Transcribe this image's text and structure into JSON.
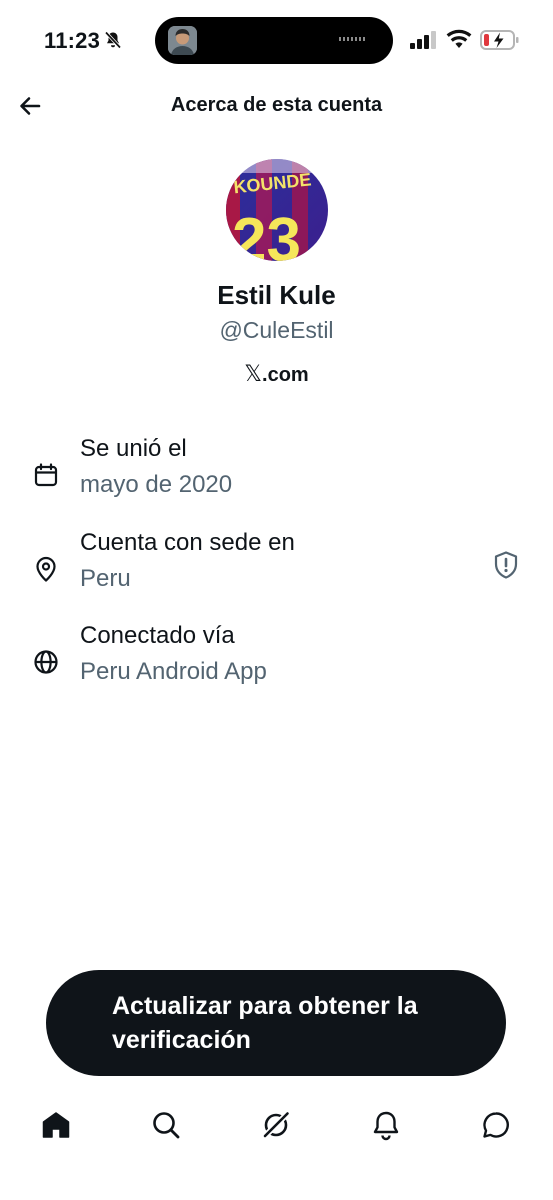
{
  "status_bar": {
    "time": "11:23",
    "icons": [
      "bell-slash-icon",
      "signal-icon",
      "wifi-icon",
      "battery-charging-icon"
    ],
    "battery_color": "#e0383e"
  },
  "header": {
    "title": "Acerca de esta cuenta",
    "back_icon": "arrow-left-icon"
  },
  "profile": {
    "display_name": "Estil Kule",
    "handle": "@CuleEstil",
    "domain_glyph": "𝕏",
    "domain_suffix": ".com",
    "avatar_jersey_text": "KOUNDE",
    "avatar_jersey_number": "23"
  },
  "info": [
    {
      "icon": "calendar-icon",
      "title": "Se unió el",
      "value": "mayo de 2020"
    },
    {
      "icon": "location-pin-icon",
      "title": "Cuenta con sede en",
      "value": "Peru",
      "action_icon": "shield-alert-icon"
    },
    {
      "icon": "globe-icon",
      "title": "Conectado vía",
      "value": "Peru Android App"
    }
  ],
  "cta": {
    "label": "Actualizar para obtener la verificación"
  },
  "tab_bar": {
    "tabs": [
      "home-icon",
      "search-icon",
      "grok-icon",
      "notifications-icon",
      "messages-icon"
    ]
  },
  "colors": {
    "text_primary": "#0f1419",
    "text_secondary": "#536471",
    "button_bg": "#0f1419"
  }
}
